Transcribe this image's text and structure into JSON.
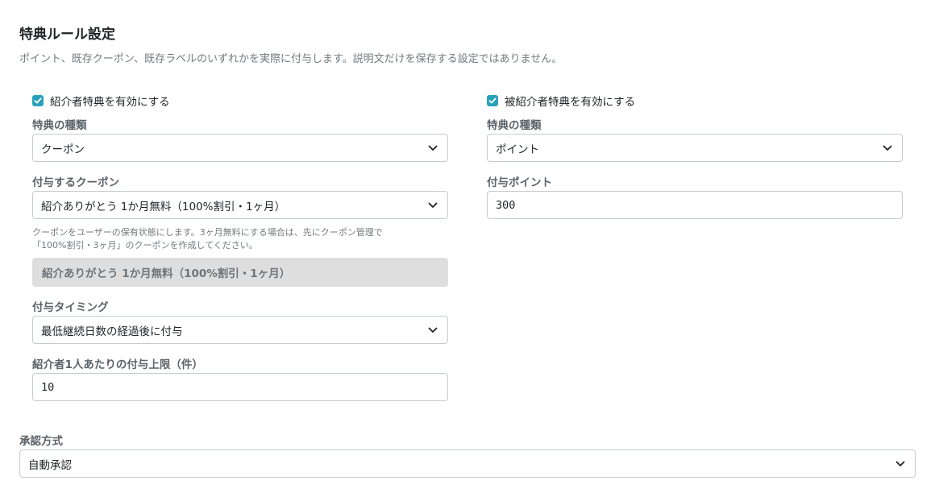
{
  "page": {
    "title": "特典ルール設定",
    "subtitle": "ポイント、既存クーポン、既存ラベルのいずれかを実際に付与します。説明文だけを保存する設定ではありません。"
  },
  "referrer": {
    "enable_label": "紹介者特典を有効にする",
    "enabled": true,
    "type_label": "特典の種類",
    "type_value": "クーポン",
    "coupon_label": "付与するクーポン",
    "coupon_value": "紹介ありがとう 1か月無料（100%割引・1ヶ月）",
    "coupon_help_line1": "クーポンをユーザーの保有状態にします。3ヶ月無料にする場合は、先にクーポン管理で",
    "coupon_help_line2": "「100%割引・3ヶ月」のクーポンを作成してください。",
    "coupon_preview": "紹介ありがとう 1か月無料（100%割引・1ヶ月）",
    "timing_label": "付与タイミング",
    "timing_value": "最低継続日数の経過後に付与",
    "limit_label": "紹介者1人あたりの付与上限（件）",
    "limit_value": "10"
  },
  "referee": {
    "enable_label": "被紹介者特典を有効にする",
    "enabled": true,
    "type_label": "特典の種類",
    "type_value": "ポイント",
    "points_label": "付与ポイント",
    "points_value": "300"
  },
  "approval": {
    "label": "承認方式",
    "value": "自動承認"
  },
  "colors": {
    "accent": "#2aa1b8",
    "border": "#c6cbcf",
    "muted_text": "#737a80",
    "label_text": "#5c6369",
    "disabled_bg": "#dedede"
  },
  "icons": {
    "check": "checkmark-icon",
    "chevron": "chevron-down-icon"
  }
}
